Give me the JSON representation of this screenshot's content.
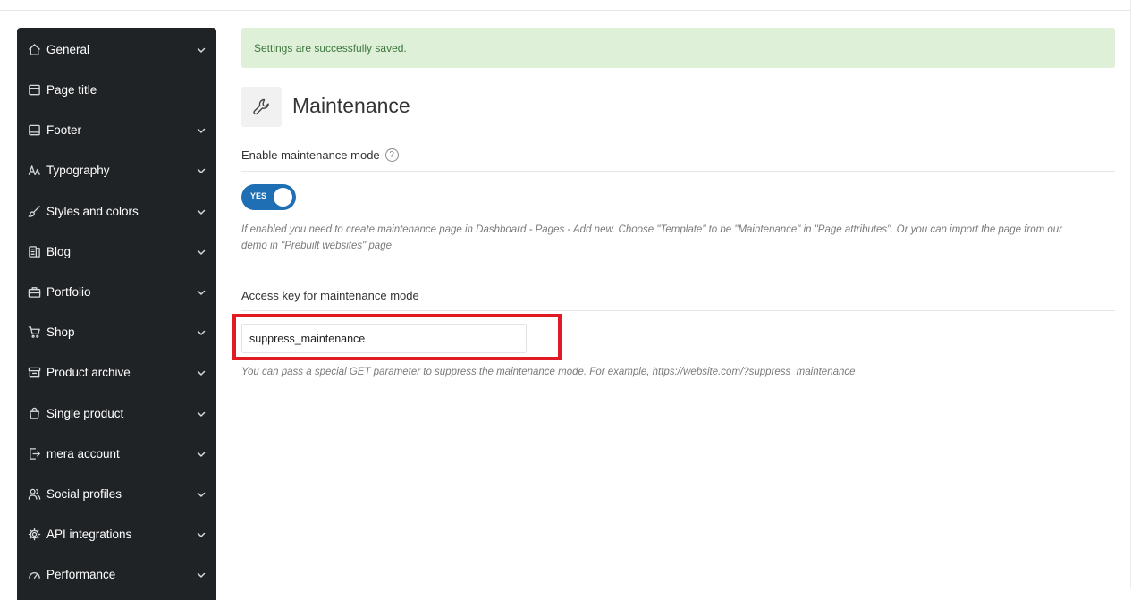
{
  "sidebar": {
    "items": [
      {
        "label": "General",
        "icon": "home-icon",
        "has_chevron": true
      },
      {
        "label": "Page title",
        "icon": "page-title-icon",
        "has_chevron": false
      },
      {
        "label": "Footer",
        "icon": "footer-icon",
        "has_chevron": true
      },
      {
        "label": "Typography",
        "icon": "typography-icon",
        "has_chevron": true
      },
      {
        "label": "Styles and colors",
        "icon": "brush-icon",
        "has_chevron": true
      },
      {
        "label": "Blog",
        "icon": "blog-icon",
        "has_chevron": true
      },
      {
        "label": "Portfolio",
        "icon": "briefcase-icon",
        "has_chevron": true
      },
      {
        "label": "Shop",
        "icon": "cart-icon",
        "has_chevron": true
      },
      {
        "label": "Product archive",
        "icon": "archive-icon",
        "has_chevron": true
      },
      {
        "label": "Single product",
        "icon": "bag-icon",
        "has_chevron": true
      },
      {
        "label": "mera account",
        "icon": "login-icon",
        "has_chevron": true
      },
      {
        "label": "Social profiles",
        "icon": "users-icon",
        "has_chevron": true
      },
      {
        "label": "API integrations",
        "icon": "gear-icon",
        "has_chevron": true
      },
      {
        "label": "Performance",
        "icon": "gauge-icon",
        "has_chevron": true
      }
    ]
  },
  "alert": {
    "text": "Settings are successfully saved."
  },
  "page": {
    "title": "Maintenance",
    "icon": "wrench-icon"
  },
  "maintenance_mode": {
    "label": "Enable maintenance mode",
    "help": "?",
    "toggle_text": "YES",
    "enabled": true,
    "description_line1": "If enabled you need to create maintenance page in Dashboard - Pages - Add new. Choose \"Template\" to be \"Maintenance\" in \"Page attributes\". Or you can import the page from our",
    "description_line2": "demo in \"Prebuilt websites\" page"
  },
  "access_key": {
    "label": "Access key for maintenance mode",
    "value": "suppress_maintenance",
    "description": "You can pass a special GET parameter to suppress the maintenance mode. For example, https://website.com/?suppress_maintenance"
  },
  "colors": {
    "sidebar_bg": "#202326",
    "toggle_on": "#1e6fb3",
    "alert_bg": "#dff0d8",
    "alert_text": "#3c763d",
    "highlight_box": "#e01b24"
  }
}
